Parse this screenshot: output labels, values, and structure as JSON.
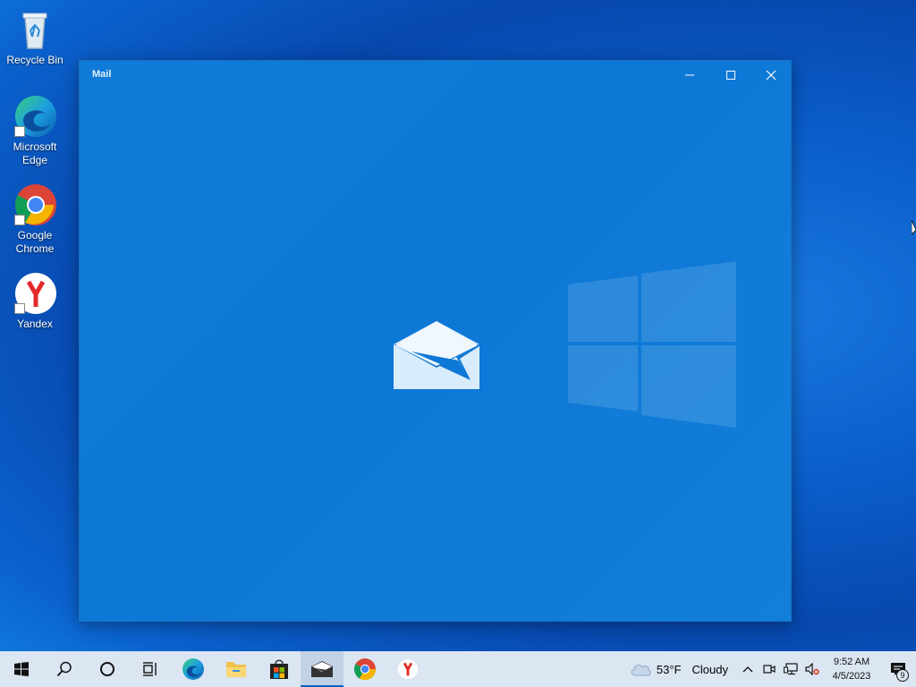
{
  "desktop": {
    "icons": [
      {
        "label": "Recycle Bin"
      },
      {
        "label": "Microsoft Edge"
      },
      {
        "label": "Google Chrome"
      },
      {
        "label": "Yandex"
      }
    ]
  },
  "window": {
    "title": "Mail",
    "minimize_icon": "minimize-icon",
    "maximize_icon": "maximize-icon",
    "close_icon": "close-icon",
    "splash_icon": "mail-envelope-icon"
  },
  "taskbar": {
    "items": [
      "start-icon",
      "search-icon",
      "cortana-icon",
      "task-view-icon",
      "edge-icon",
      "file-explorer-icon",
      "store-icon",
      "mail-icon",
      "chrome-icon",
      "yandex-icon"
    ],
    "active": "mail-icon",
    "weather": {
      "temp": "53°F",
      "condition": "Cloudy"
    },
    "clock": {
      "time": "9:52 AM",
      "date": "4/5/2023"
    },
    "notifications_count": "9"
  },
  "colors": {
    "accent": "#0078d7",
    "window_bg": "#0e78d6",
    "taskbar_bg": "#dbe6f2"
  }
}
